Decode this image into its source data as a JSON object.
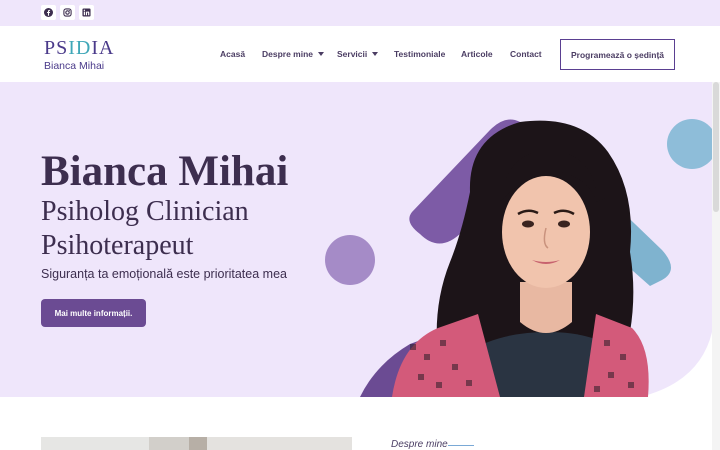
{
  "topbar": {
    "social": [
      {
        "icon": "facebook-icon"
      },
      {
        "icon": "instagram-icon"
      },
      {
        "icon": "linkedin-icon"
      }
    ]
  },
  "header": {
    "logo_word": "PSIDIA",
    "logo_name": "Bianca Mihai",
    "nav": [
      {
        "label": "Acasă",
        "has_dropdown": false,
        "active": true
      },
      {
        "label": "Despre mine",
        "has_dropdown": true
      },
      {
        "label": "Servicii",
        "has_dropdown": true
      },
      {
        "label": "Testimoniale",
        "has_dropdown": false
      },
      {
        "label": "Articole",
        "has_dropdown": false
      },
      {
        "label": "Contact",
        "has_dropdown": false
      }
    ],
    "cta_label": "Programează o ședință"
  },
  "hero": {
    "title": "Bianca Mihai",
    "subtitle_line1": "Psiholog Clinician",
    "subtitle_line2": "Psihoterapeut",
    "tagline": "Siguranța ta emoțională este prioritatea mea",
    "button_label": "Mai multe informații."
  },
  "about": {
    "label": "Despre mine"
  },
  "colors": {
    "brand_purple": "#6b4b93",
    "light_lilac": "#efe6fb",
    "teal": "#3fa7b8",
    "blue_circle": "#8ebdd9",
    "text_dark": "#3d2e4f"
  }
}
